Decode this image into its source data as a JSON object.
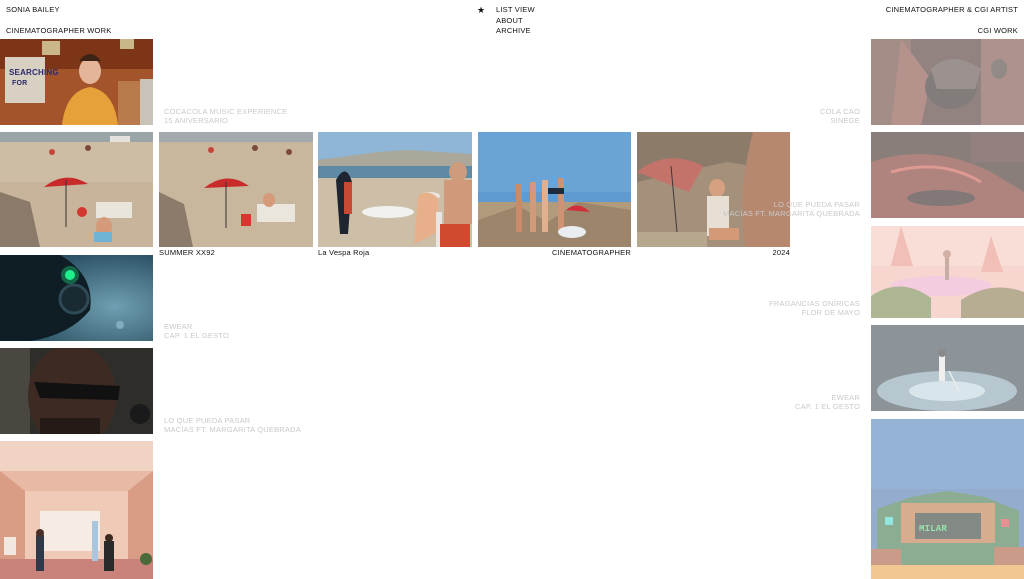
{
  "header": {
    "brand": "SONIA BAILEY",
    "left_section": "CINEMATOGRAPHER WORK",
    "star": "★",
    "nav": [
      "LIST VIEW",
      "ABOUT",
      "ARCHIVE"
    ],
    "right_title": "CINEMATOGRAPHER & CGI ARTIST",
    "right_section": "CGI WORK"
  },
  "left_column": [
    {
      "title": "COCACOLA MUSIC EXPERIENCE",
      "subtitle": "15 ANIVERSARIO"
    },
    {
      "title": "",
      "subtitle": ""
    },
    {
      "title": "EWEAR",
      "subtitle": "CAP. 1 EL GESTO"
    },
    {
      "title": "LO QUE PUEDA PASAR",
      "subtitle": "MACÍAS FT. MARGARITA QUEBRADA"
    },
    {
      "title": "",
      "subtitle": ""
    }
  ],
  "right_column": [
    {
      "title": "COLA CAO",
      "subtitle": "SINEGE"
    },
    {
      "title": "LO QUE PUEDA PASAR",
      "subtitle": "MACÍAS FT. MARGARITA QUEBRADA"
    },
    {
      "title": "FRAGANCIAS ONÍRICAS",
      "subtitle": "FLOR DE MAYO"
    },
    {
      "title": "EWEAR",
      "subtitle": "CAP. 1 EL GESTO"
    },
    {
      "title": "",
      "subtitle": ""
    }
  ],
  "project_row": {
    "captions": [
      "SUMMER XX92",
      "La Vespa Roja",
      "CINEMATOGRAPHER",
      "2024"
    ]
  },
  "colors": {
    "text": "#111111",
    "muted": "#c9c9c9",
    "background": "#ffffff"
  }
}
